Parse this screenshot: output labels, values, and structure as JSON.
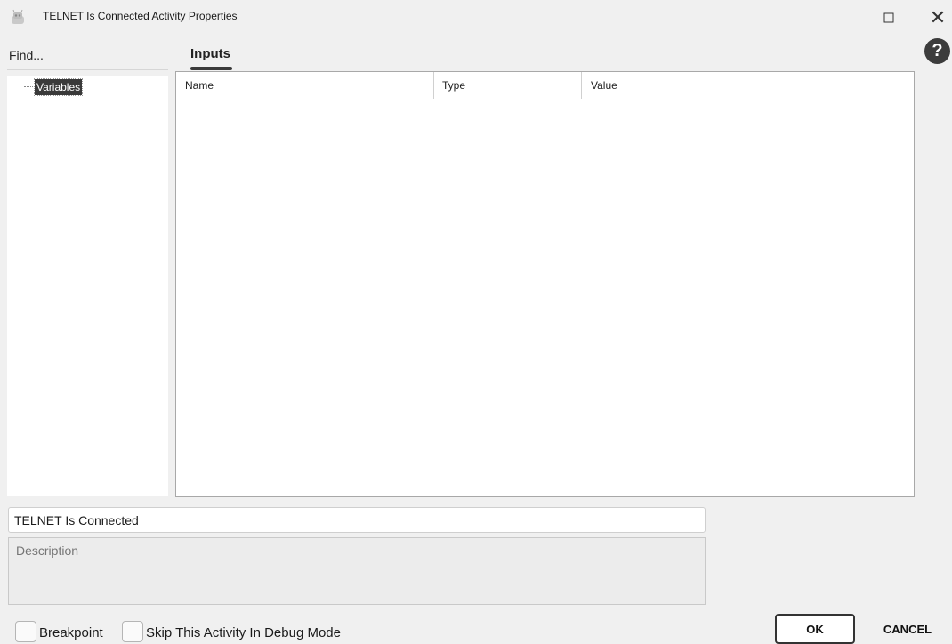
{
  "window": {
    "title": "TELNET Is Connected Activity Properties",
    "close_glyph": "✕"
  },
  "help": {
    "glyph": "?"
  },
  "left_panel": {
    "find_label": "Find...",
    "tree_items": [
      {
        "label": "Variables",
        "selected": true
      }
    ]
  },
  "tabs": [
    {
      "label": "Inputs",
      "active": true
    }
  ],
  "table": {
    "columns": [
      "Name",
      "Type",
      "Value"
    ],
    "rows": []
  },
  "activity": {
    "name_value": "TELNET Is Connected",
    "description_placeholder": "Description"
  },
  "footer": {
    "breakpoint_label": "Breakpoint",
    "skip_label": "Skip This Activity In Debug Mode",
    "ok_label": "OK",
    "cancel_label": "CANCEL"
  },
  "colors": {
    "background": "#f0f0f0",
    "selection": "#3a3a3a",
    "panel": "#ffffff"
  }
}
